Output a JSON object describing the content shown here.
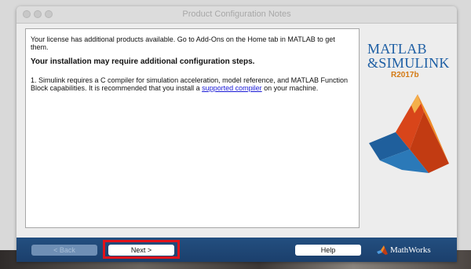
{
  "window": {
    "title": "Product Configuration Notes"
  },
  "content": {
    "intro": "Your license has additional products available. Go to Add-Ons on the Home tab in MATLAB to get them.",
    "heading": "Your installation may require additional configuration steps.",
    "note_prefix": "1. Simulink requires a C compiler for simulation acceleration, model reference, and MATLAB Function Block capabilities. It is recommended that you install a ",
    "note_link": "supported compiler",
    "note_suffix": " on your machine."
  },
  "logo": {
    "matlab": "MATLAB",
    "simulink": "&SIMULINK",
    "release": "R2017b"
  },
  "footer": {
    "back_label": "< Back",
    "next_label": "Next >",
    "help_label": "Help",
    "brand": "MathWorks"
  },
  "colors": {
    "footer_bg": "#234f80",
    "highlight": "#e0121b",
    "logo_blue": "#1e5fa4",
    "release_orange": "#d47a14"
  }
}
